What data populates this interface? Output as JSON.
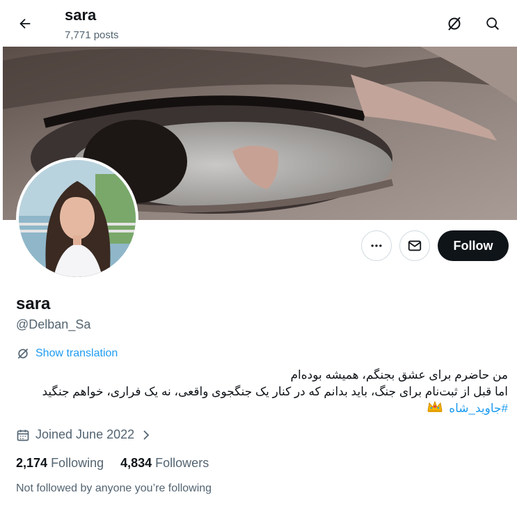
{
  "header": {
    "name": "sara",
    "posts": "7,771 posts"
  },
  "profile": {
    "name": "sara",
    "handle": "@Delban_Sa",
    "follow_label": "Follow",
    "translation_label": "Show translation",
    "bio_line1": "من حاضرم برای عشق بجنگم، همیشه بوده‌ام",
    "bio_line2": "اما قبل از ثبت‌نام برای جنگ، باید بدانم که در کنار یک جنگجوی واقعی، نه یک فراری، خواهم جنگید",
    "hashtag": "#جاوید_شاه",
    "joined": "Joined June 2022",
    "following_count": "2,174",
    "following_label": "Following",
    "followers_count": "4,834",
    "followers_label": "Followers",
    "not_followed": "Not followed by anyone you’re following"
  },
  "colors": {
    "accent": "#1d9bf0",
    "text": "#0f1419",
    "muted": "#536471",
    "follow_bg": "#0f1419"
  },
  "icons": [
    "back-arrow-icon",
    "translate-off-icon",
    "search-icon",
    "more-icon",
    "mail-icon",
    "calendar-icon",
    "chevron-right-icon",
    "crown-icon"
  ]
}
